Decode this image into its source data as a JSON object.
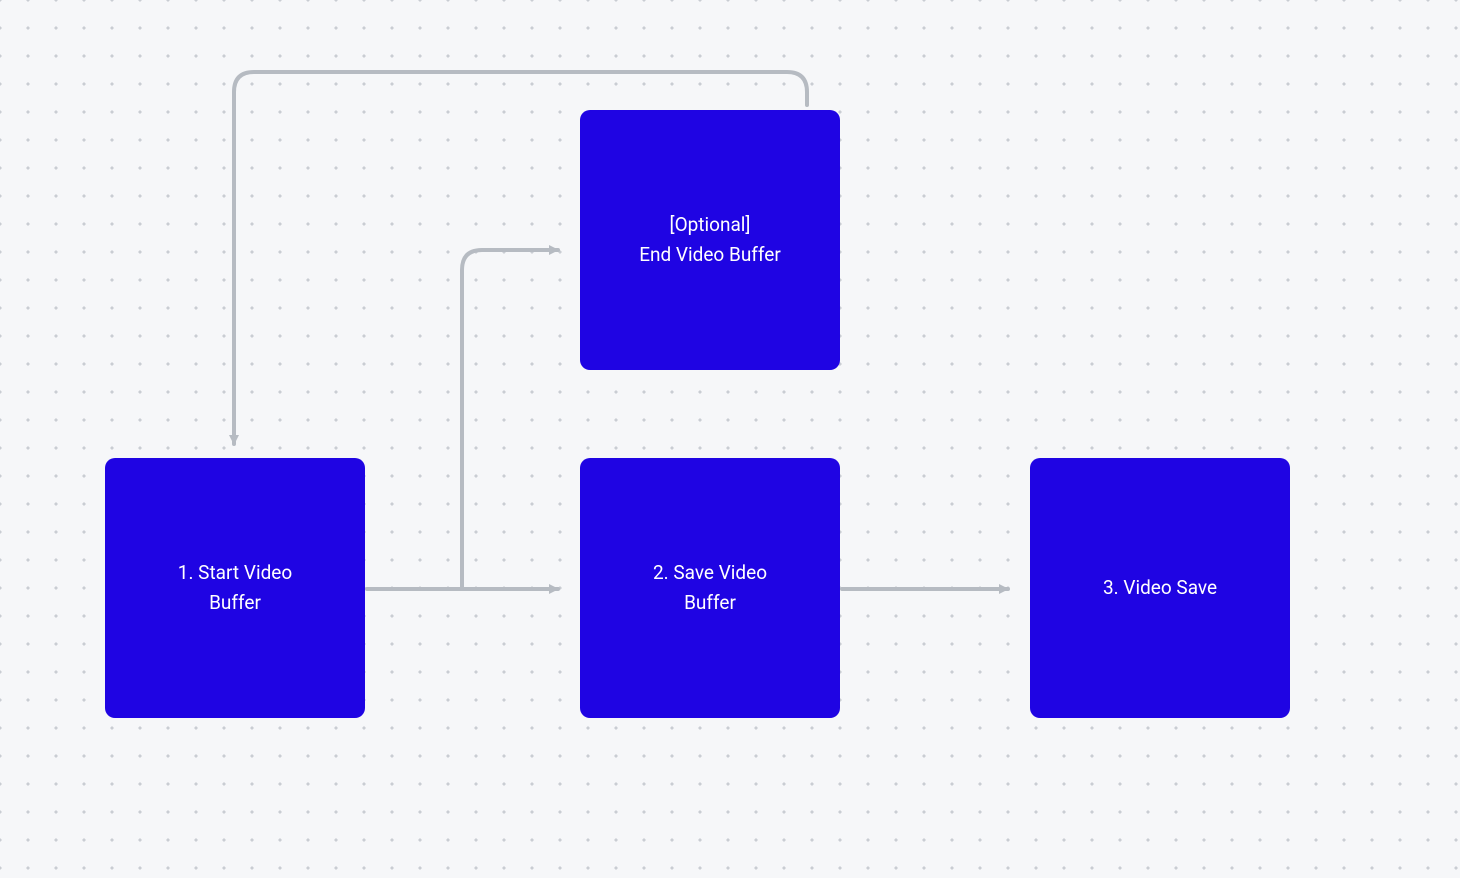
{
  "nodes": {
    "start": {
      "line1": "1. Start Video",
      "line2": "Buffer"
    },
    "optional": {
      "line1": "[Optional]",
      "line2": "End Video Buffer"
    },
    "save_buffer": {
      "line1": "2. Save Video",
      "line2": "Buffer"
    },
    "video_save": {
      "line1": "3. Video Save"
    }
  },
  "colors": {
    "node_bg": "#1f04e3",
    "arrow": "#b6bbc2",
    "canvas_bg": "#f6f7f9",
    "dot": "#c9cdd3"
  }
}
